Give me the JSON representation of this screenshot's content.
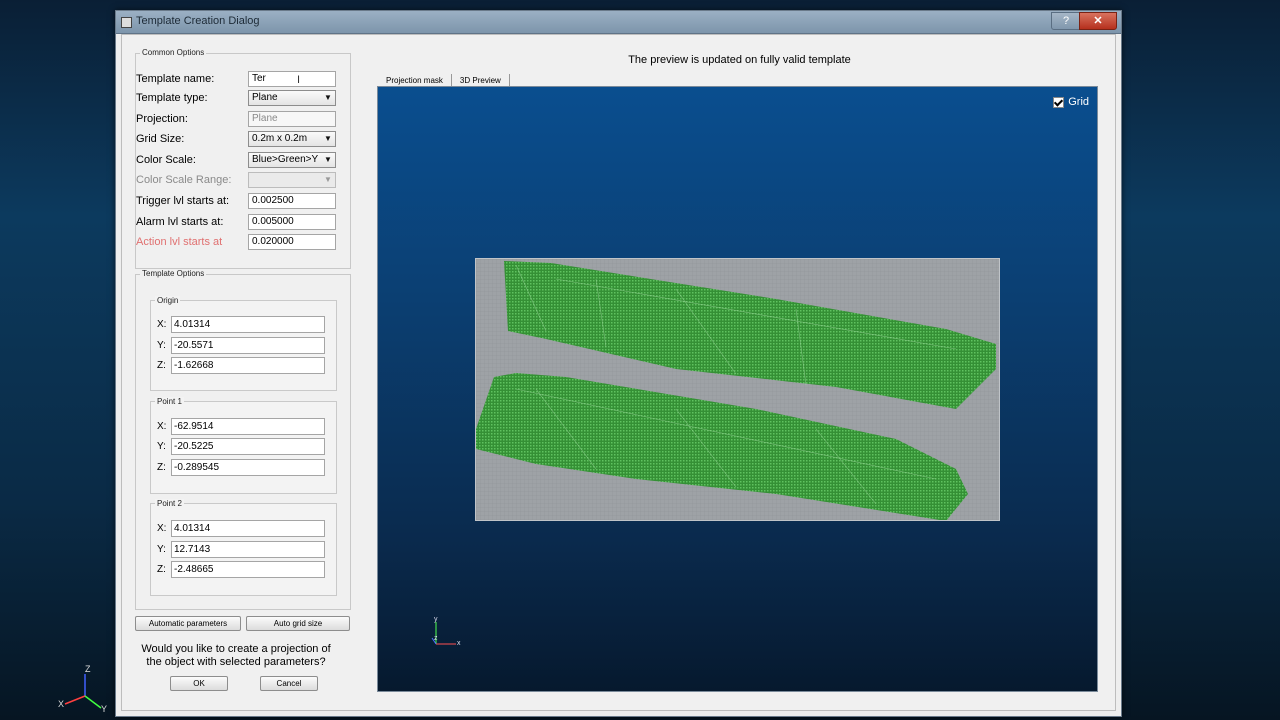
{
  "window": {
    "title": "Template Creation Dialog",
    "help_label": "?",
    "close_label": "✕"
  },
  "common_options": {
    "group_label": "Common Options",
    "template_name": {
      "label": "Template name:",
      "value": "Ter"
    },
    "template_type": {
      "label": "Template type:",
      "value": "Plane"
    },
    "projection": {
      "label": "Projection:",
      "value": "Plane"
    },
    "grid_size": {
      "label": "Grid Size:",
      "value": "0.2m x 0.2m"
    },
    "color_scale": {
      "label": "Color Scale:",
      "value": "Blue>Green>Y"
    },
    "color_scale_range": {
      "label": "Color Scale Range:",
      "value": ""
    },
    "trigger": {
      "label": "Trigger lvl starts at:",
      "value": "0.002500"
    },
    "alarm": {
      "label": "Alarm lvl starts at:",
      "value": "0.005000"
    },
    "action": {
      "label": "Action lvl starts at",
      "value": "0.020000"
    }
  },
  "template_options": {
    "group_label": "Template Options",
    "origin": {
      "label": "Origin",
      "x": "4.01314",
      "y": "-20.5571",
      "z": "-1.62668"
    },
    "point1": {
      "label": "Point 1",
      "x": "-62.9514",
      "y": "-20.5225",
      "z": "-0.289545"
    },
    "point2": {
      "label": "Point 2",
      "x": "4.01314",
      "y": "12.7143",
      "z": "-2.48665"
    },
    "axis_labels": {
      "x": "X:",
      "y": "Y:",
      "z": "Z:"
    }
  },
  "buttons": {
    "auto_params": "Automatic parameters",
    "auto_grid": "Auto grid size",
    "ok": "OK",
    "cancel": "Cancel"
  },
  "question": {
    "line1": "Would you like to create a projection of",
    "line2": "the object with selected parameters?"
  },
  "preview": {
    "status": "The preview is updated on fully valid template",
    "tabs": [
      "Projection mask",
      "3D Preview"
    ],
    "grid_label": "Grid",
    "grid_checked": true
  },
  "axes": {
    "x": "x",
    "y": "y",
    "z": "z"
  },
  "desktop_axes": {
    "x": "X",
    "y": "Y",
    "z": "Z"
  },
  "colors": {
    "point_cloud": "#3aa33a",
    "accent_red": "#e07070"
  },
  "icons": {
    "dropdown": "chevron-down-icon",
    "check": "check-icon",
    "cursor": "text-cursor-icon"
  }
}
